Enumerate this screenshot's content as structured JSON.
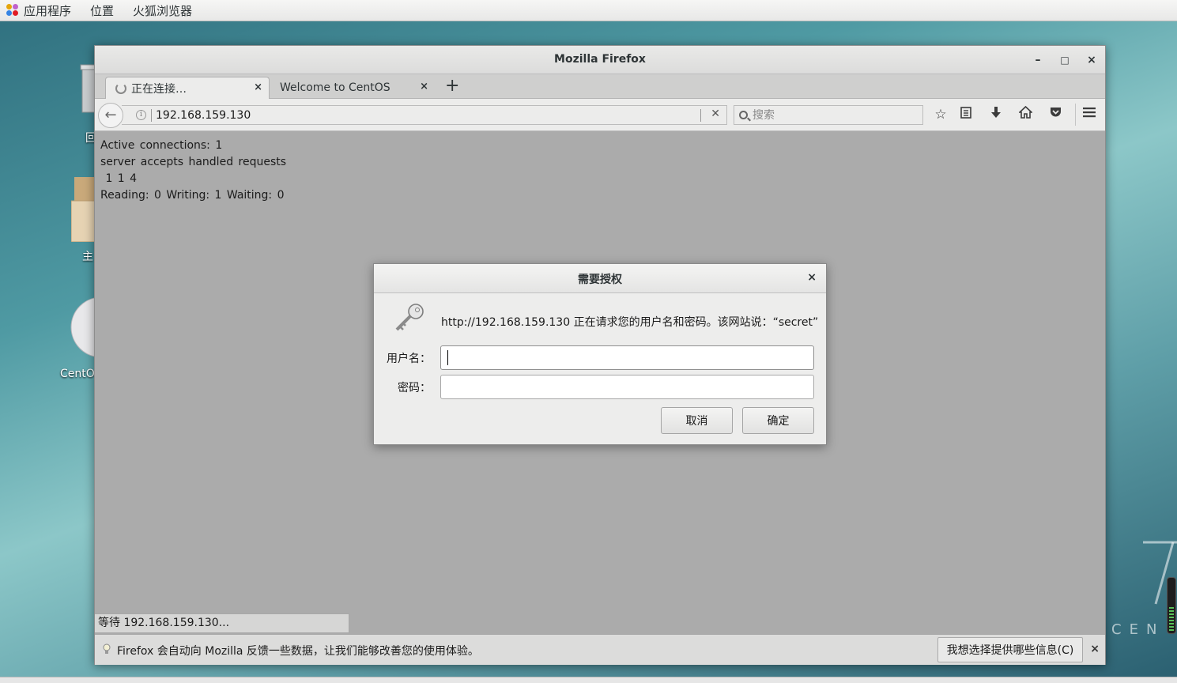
{
  "topbar": {
    "applications": "应用程序",
    "places": "位置",
    "firefox": "火狐浏览器"
  },
  "desktop": {
    "trash_label": "回",
    "home_label": "主",
    "disc_label": "CentO"
  },
  "window": {
    "title": "Mozilla Firefox",
    "controls": {
      "minimize": "–",
      "maximize": "□",
      "close": "×"
    }
  },
  "tabs": [
    {
      "label": "正在连接…",
      "close": "×"
    },
    {
      "label": "Welcome to CentOS",
      "close": "×"
    }
  ],
  "new_tab": "+",
  "navbar": {
    "url": "192.168.159.130",
    "search_placeholder": "搜索"
  },
  "page": {
    "lines": [
      "Active connections: 1",
      "server accepts handled requests",
      " 1 1 4",
      "Reading: 0 Writing: 1 Waiting: 0"
    ],
    "status": "等待 192.168.159.130..."
  },
  "notification": {
    "text": "Firefox 会自动向 Mozilla 反馈一些数据，让我们能够改善您的使用体验。",
    "button": "我想选择提供哪些信息(C)",
    "close": "×"
  },
  "dialog": {
    "title": "需要授权",
    "close": "×",
    "message": "http://192.168.159.130 正在请求您的用户名和密码。该网站说：“secret”",
    "username_label": "用户名：",
    "password_label": "密码：",
    "username_value": "",
    "password_value": "",
    "cancel": "取消",
    "ok": "确定"
  },
  "watermark": "CEN",
  "colors": {
    "window_content": "#ababab",
    "dialog_bg": "#ededec",
    "volume_green": "#59c25a"
  }
}
